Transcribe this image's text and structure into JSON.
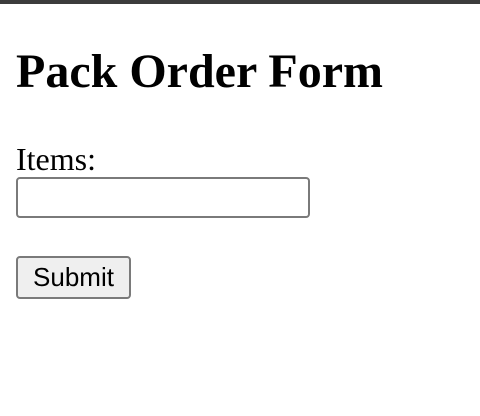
{
  "form": {
    "title": "Pack Order Form",
    "items_label": "Items:",
    "items_value": "",
    "items_placeholder": "",
    "submit_label": "Submit"
  }
}
